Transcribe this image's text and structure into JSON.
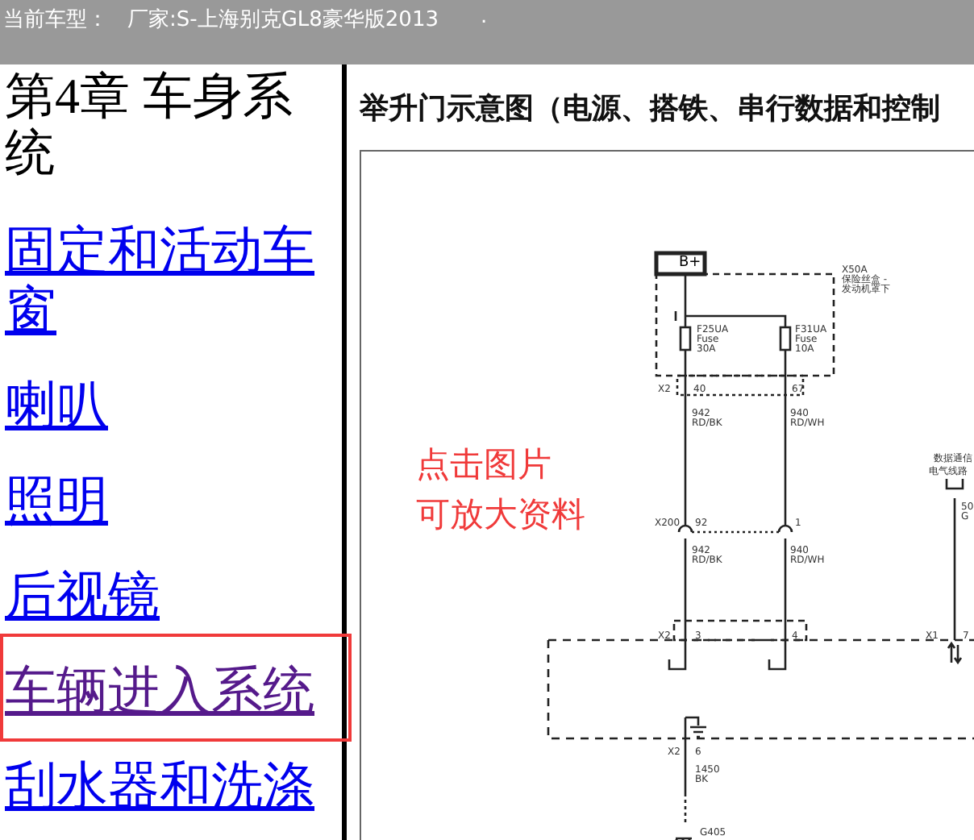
{
  "header": {
    "label": "当前车型：",
    "vehicle": "厂家:S-上海别克GL8豪华版2013",
    "mark": "."
  },
  "nav": {
    "heading": "第4章 车身系统",
    "items": [
      {
        "label": "固定和活动车窗",
        "visited": false,
        "highlighted": false
      },
      {
        "label": "喇叭",
        "visited": false,
        "highlighted": false
      },
      {
        "label": "照明",
        "visited": false,
        "highlighted": false
      },
      {
        "label": "后视镜",
        "visited": false,
        "highlighted": false
      },
      {
        "label": "车辆进入系统",
        "visited": true,
        "highlighted": true
      },
      {
        "label": "刮水器和洗涤",
        "visited": false,
        "highlighted": false
      }
    ]
  },
  "document": {
    "title": "举升门示意图（电源、搭铁、串行数据和控制",
    "overlay": [
      "点击图片",
      "可放大资料"
    ],
    "diagram_labels": [
      "B+",
      "X50A",
      "保险丝盒 -",
      "发动机罩下",
      "F25UA",
      "Fuse",
      "30A",
      "F31UA",
      "Fuse",
      "10A",
      "X2",
      "40",
      "67",
      "942",
      "RD/BK",
      "940",
      "RD/WH",
      "数据通信",
      "电气线路",
      "X200",
      "92",
      "1",
      "942",
      "RD/BK",
      "940",
      "RD/WH",
      "50",
      "G",
      "X2",
      "3",
      "4",
      "X1",
      "7",
      "X2",
      "6",
      "1450",
      "BK",
      "G405"
    ]
  }
}
